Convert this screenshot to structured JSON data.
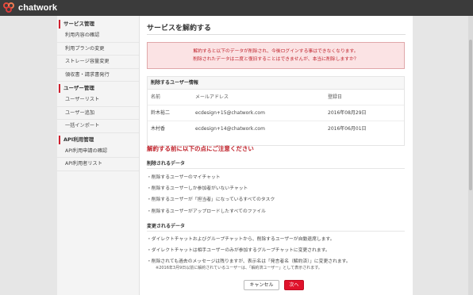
{
  "app": {
    "logo_text": "chatwork"
  },
  "sidebar": {
    "sections": [
      {
        "title": "サービス管理",
        "items": [
          "利用内容の確認",
          "利用プランの変更",
          "ストレージ容量変更",
          "領収書・請求書発行"
        ]
      },
      {
        "title": "ユーザー管理",
        "items": [
          "ユーザーリスト",
          "ユーザー追加",
          "一括インポート"
        ]
      },
      {
        "title": "API利用管理",
        "items": [
          "API利用申請の確認",
          "API利用者リスト"
        ]
      }
    ]
  },
  "main": {
    "title": "サービスを解約する",
    "alert_line1": "解約すると以下のデータが削除され、今後ログインする事はできなくなります。",
    "alert_line2": "削除されたデータは二度と復旧することはできませんが、本当に削除しますか？",
    "users": {
      "heading": "削除するユーザー情報",
      "columns": [
        "名前",
        "メールアドレス",
        "登録日"
      ],
      "rows": [
        [
          "鈴木裕二",
          "ecdesign+15@chatwork.com",
          "2016年08月29日"
        ],
        [
          "木村香",
          "ecdesign+14@chatwork.com",
          "2016年06月01日"
        ]
      ]
    },
    "warning_heading": "解約する前に以下の点にご注意ください",
    "deleted": {
      "heading": "削除されるデータ",
      "items": [
        "・削除するユーザーのマイチャット",
        "・削除するユーザーしか参加者がいないチャット",
        "・削除するユーザーが「担当者」になっているすべてのタスク",
        "・削除するユーザーがアップロードしたすべてのファイル"
      ]
    },
    "changed": {
      "heading": "変更されるデータ",
      "items": [
        "・ダイレクトチャットおよびグループチャットから、削除するユーザーが自動退席します。",
        "・ダイレクトチャットは相手ユーザーのみが参加するグループチャットに変更されます。",
        "・削除されても過去のメッセージは残りますが、表示名は「発言者名（解約済）」に変更されます。"
      ],
      "note": "※2016年3月9日以前に解約されているユーザーは、「解約済ユーザー」として表示されます。"
    },
    "buttons": {
      "cancel": "キャンセル",
      "next": "次へ"
    }
  }
}
